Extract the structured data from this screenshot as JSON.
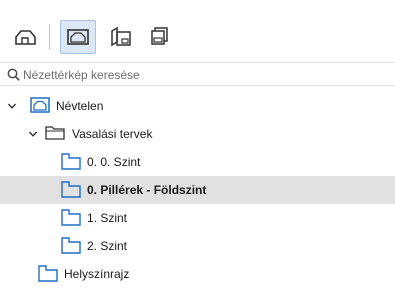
{
  "toolbar": {
    "buttons": [
      {
        "name": "project-map-icon",
        "active": false
      },
      {
        "name": "view-map-icon",
        "active": true
      },
      {
        "name": "layout-book-icon",
        "active": false
      },
      {
        "name": "publisher-sets-icon",
        "active": false
      }
    ]
  },
  "search": {
    "placeholder": "Nézettérkép keresése",
    "value": ""
  },
  "tree": {
    "items": [
      {
        "label": "Névtelen",
        "icon": "view-map-icon",
        "expanded": true,
        "level": 0,
        "selected": false
      },
      {
        "label": "Vasalási tervek",
        "icon": "folder-icon",
        "expanded": true,
        "level": 1,
        "selected": false
      },
      {
        "label": "0. 0. Szint",
        "icon": "floor-plan-icon",
        "level": 2,
        "selected": false
      },
      {
        "label": "0. Pillérek - Földszint",
        "icon": "floor-plan-icon",
        "level": 2,
        "selected": true
      },
      {
        "label": "1. Szint",
        "icon": "floor-plan-icon",
        "level": 2,
        "selected": false
      },
      {
        "label": "2. Szint",
        "icon": "floor-plan-icon",
        "level": 2,
        "selected": false
      },
      {
        "label": "Helyszínrajz",
        "icon": "floor-plan-icon",
        "level": 1,
        "selected": false
      }
    ]
  },
  "colors": {
    "accent": "#1f6fc5",
    "selection": "#e1e1e1",
    "active_button": "#dbe7f4"
  }
}
